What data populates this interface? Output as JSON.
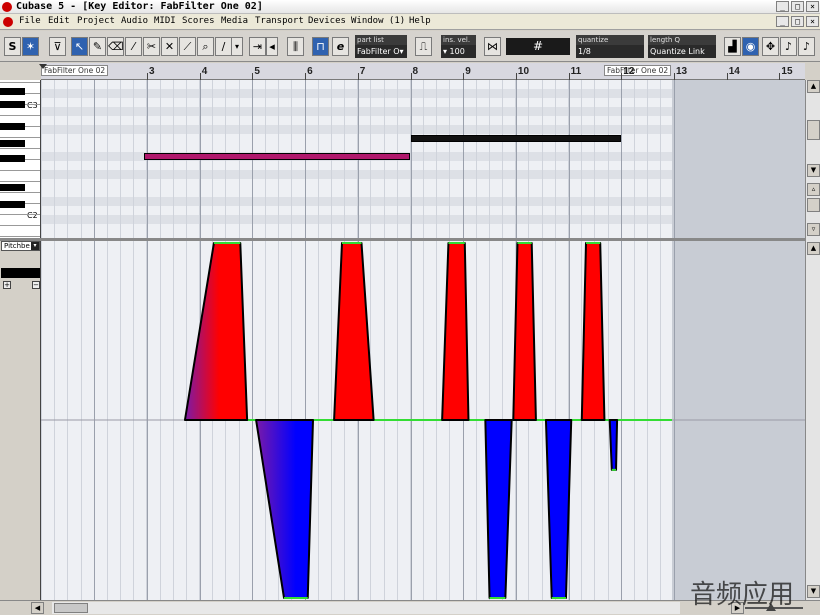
{
  "window": {
    "title": "Cubase 5 - [Key Editor: FabFilter One 02]",
    "min_glyph": "_",
    "max_glyph": "□",
    "close_glyph": "×"
  },
  "menu": [
    "File",
    "Edit",
    "Project",
    "Audio",
    "MIDI",
    "Scores",
    "Media",
    "Transport",
    "Devices",
    "Window (1)",
    "Help"
  ],
  "toolbar": {
    "solo_label": "S",
    "part_list_label": "part list",
    "part_list_value": "FabFilter O▾",
    "ins_vel_label": "ins. vel.",
    "ins_vel_value": "▾ 100",
    "grid_symbol": "#",
    "quantize_label": "quantize",
    "quantize_value": "1/8",
    "length_label": "length Q",
    "length_value": "Quantize Link"
  },
  "ruler": {
    "bars": [
      "3",
      "4",
      "5",
      "6",
      "7",
      "8",
      "9",
      "10",
      "11",
      "12",
      "13",
      "14",
      "15"
    ],
    "part_start_label": "FabFilter One 02",
    "part_end_label": "FabFilter One 02"
  },
  "keyboard": {
    "labels": [
      "C3",
      "C2"
    ]
  },
  "controller": {
    "lane_name": "Pitchbe",
    "plus_glyph": "+",
    "minus_glyph": "−"
  },
  "notes": [
    {
      "start_bar": 2.95,
      "end_bar": 8.0,
      "row": 8,
      "color": "#b0186c"
    },
    {
      "start_bar": 8.0,
      "end_bar": 12.0,
      "row": 6,
      "color": "#111111"
    }
  ],
  "pitchbend_events": [
    {
      "name": "bend-up-1",
      "direction": "up",
      "start_bar": 3.72,
      "peak_start_bar": 4.27,
      "peak_end_bar": 4.77,
      "end_bar": 4.9,
      "gradient": true
    },
    {
      "name": "bend-down-1",
      "direction": "down",
      "start_bar": 5.07,
      "peak_start_bar": 5.6,
      "peak_end_bar": 6.05,
      "end_bar": 6.15,
      "gradient": true
    },
    {
      "name": "bend-up-2",
      "direction": "up",
      "start_bar": 6.55,
      "peak_start_bar": 6.7,
      "peak_end_bar": 7.07,
      "end_bar": 7.3,
      "gradient": false
    },
    {
      "name": "bend-up-3",
      "direction": "up",
      "start_bar": 8.6,
      "peak_start_bar": 8.72,
      "peak_end_bar": 9.03,
      "end_bar": 9.1,
      "gradient": false
    },
    {
      "name": "bend-down-2",
      "direction": "down",
      "start_bar": 9.42,
      "peak_start_bar": 9.5,
      "peak_end_bar": 9.8,
      "end_bar": 9.92,
      "gradient": false
    },
    {
      "name": "bend-up-4",
      "direction": "up",
      "start_bar": 9.95,
      "peak_start_bar": 10.03,
      "peak_end_bar": 10.3,
      "end_bar": 10.38,
      "gradient": false
    },
    {
      "name": "bend-down-3",
      "direction": "down",
      "start_bar": 10.57,
      "peak_start_bar": 10.68,
      "peak_end_bar": 10.95,
      "end_bar": 11.05,
      "gradient": false
    },
    {
      "name": "bend-up-5",
      "direction": "up",
      "start_bar": 11.25,
      "peak_start_bar": 11.33,
      "peak_end_bar": 11.6,
      "end_bar": 11.68,
      "gradient": false
    },
    {
      "name": "bend-down-4",
      "direction": "down",
      "start_bar": 11.78,
      "peak_start_bar": 11.82,
      "peak_end_bar": 11.9,
      "end_bar": 11.92,
      "gradient": false,
      "depth": 0.28
    }
  ],
  "watermark": "音频应用",
  "colors": {
    "bend_up": "#ff0000",
    "bend_down": "#0000ff",
    "bend_mid": "#7a1aa8",
    "zero_line": "#33dd33",
    "note_pink": "#b0186c",
    "note_dark": "#111111"
  }
}
